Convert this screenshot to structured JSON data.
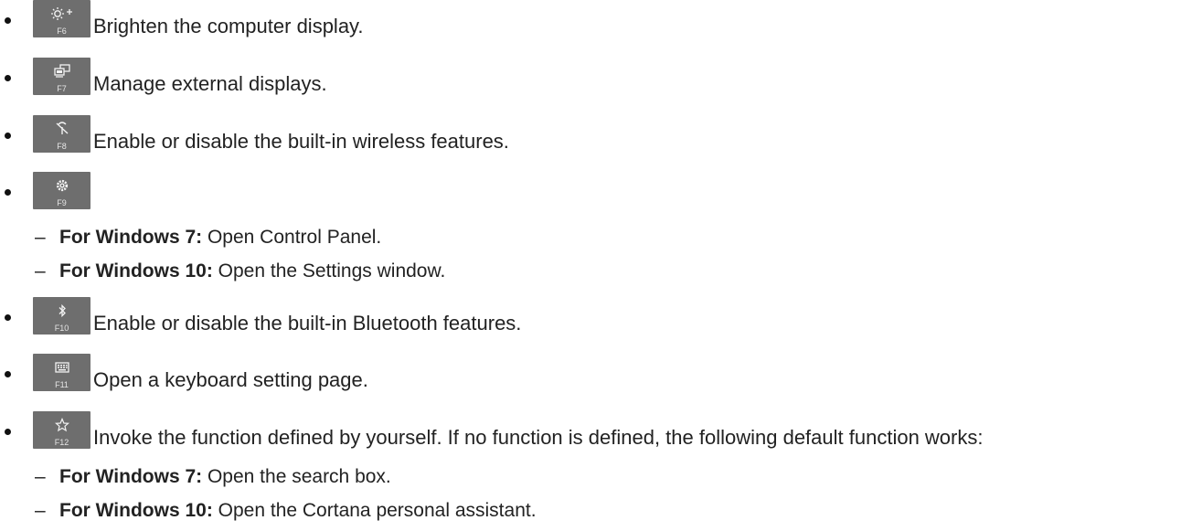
{
  "items": [
    {
      "key_label": "F6",
      "icon": "brightness-up-icon",
      "text": "Brighten the computer display."
    },
    {
      "key_label": "F7",
      "icon": "external-display-icon",
      "text": "Manage external displays."
    },
    {
      "key_label": "F8",
      "icon": "wireless-icon",
      "text": "Enable or disable the built-in wireless features."
    },
    {
      "key_label": "F9",
      "icon": "settings-gear-icon",
      "text": "",
      "subitems": [
        {
          "label": "For Windows 7:",
          "text": " Open Control Panel."
        },
        {
          "label": "For Windows 10:",
          "text": " Open the Settings window."
        }
      ]
    },
    {
      "key_label": "F10",
      "icon": "bluetooth-icon",
      "text": "Enable or disable the built-in Bluetooth features."
    },
    {
      "key_label": "F11",
      "icon": "keyboard-icon",
      "text": "Open a keyboard setting page."
    },
    {
      "key_label": "F12",
      "icon": "star-icon",
      "text": "Invoke the function defined by yourself. If no function is defined, the following default function works:",
      "subitems": [
        {
          "label": "For Windows 7:",
          "text": " Open the search box."
        },
        {
          "label": "For Windows 10:",
          "text": " Open the Cortana personal assistant."
        }
      ]
    }
  ],
  "colors": {
    "key_background": "#6e6e6e",
    "key_text": "#e6e6e6",
    "text": "#222222"
  }
}
